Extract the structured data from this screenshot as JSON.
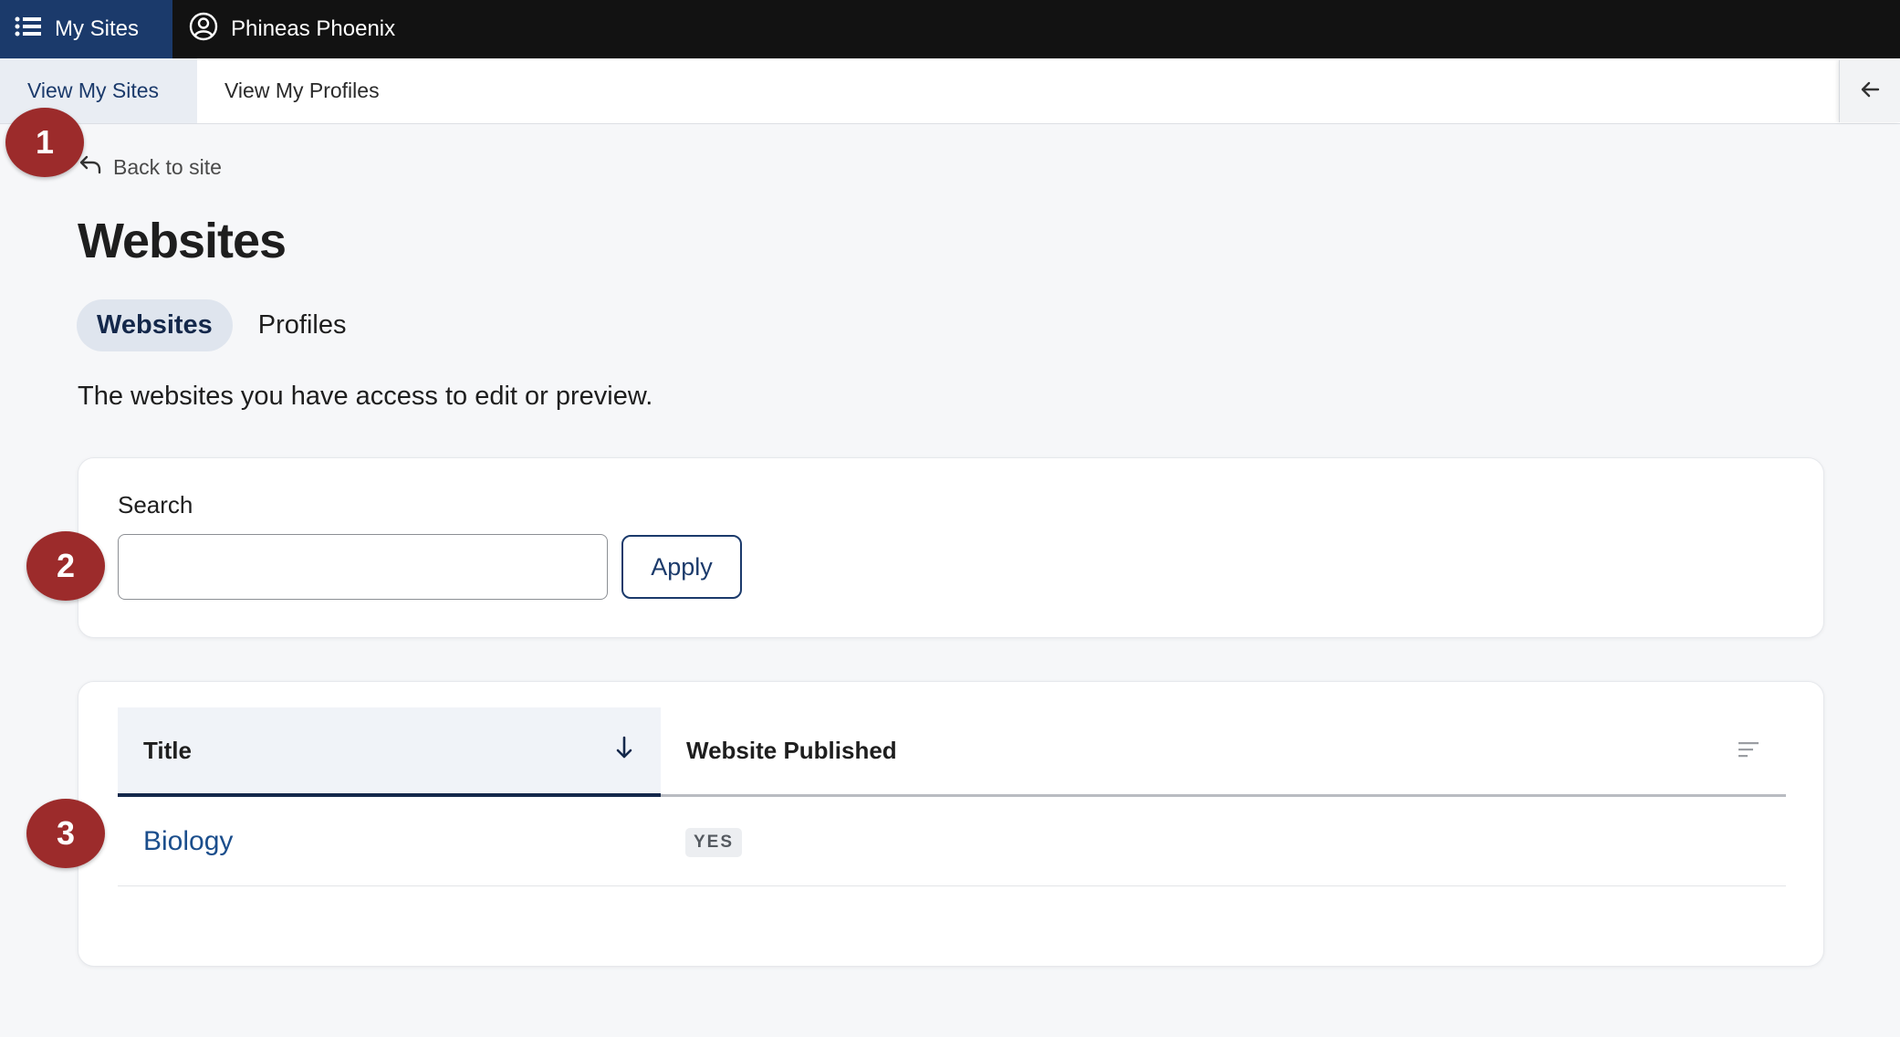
{
  "topbar": {
    "my_sites_label": "My Sites",
    "user_name": "Phineas Phoenix"
  },
  "subnav": {
    "tabs": [
      {
        "label": "View My Sites",
        "active": true
      },
      {
        "label": "View My Profiles",
        "active": false
      }
    ]
  },
  "markers": [
    "1",
    "2",
    "3"
  ],
  "back_link": "Back to site",
  "page_title": "Websites",
  "pills": [
    {
      "label": "Websites",
      "active": true
    },
    {
      "label": "Profiles",
      "active": false
    }
  ],
  "intro_text": "The websites you have access to edit or preview.",
  "search": {
    "label": "Search",
    "value": "",
    "apply_label": "Apply"
  },
  "table": {
    "columns": [
      "Title",
      "Website Published"
    ],
    "rows": [
      {
        "title": "Biology",
        "published": "YES"
      }
    ]
  },
  "colors": {
    "brand_navy": "#1b3a6b",
    "marker_red": "#9c2b2b",
    "link_blue": "#1b4e8c"
  }
}
